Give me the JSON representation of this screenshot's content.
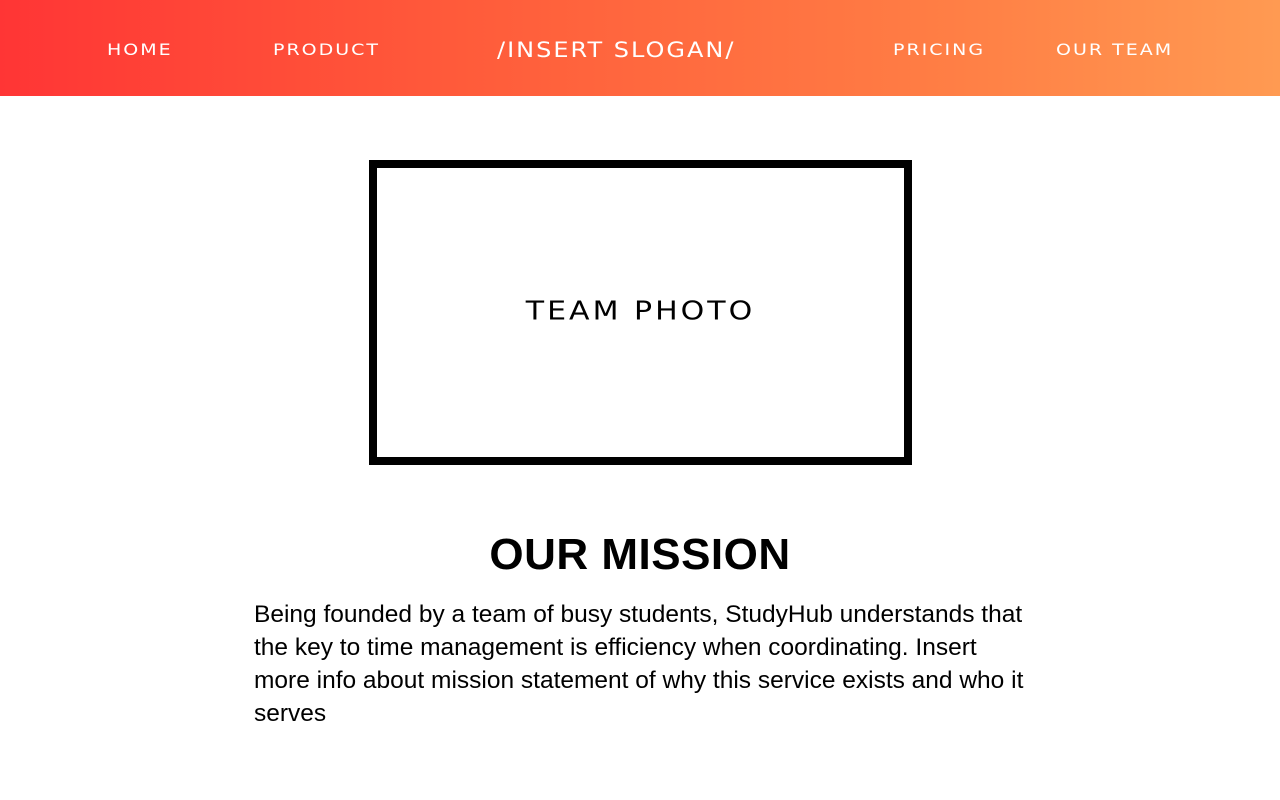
{
  "nav": {
    "home": "HOME",
    "product": "PRODUCT",
    "slogan": "/INSERT SLOGAN/",
    "pricing": "PRICING",
    "our_team": "OUR TEAM"
  },
  "hero": {
    "photo_label": "TEAM PHOTO"
  },
  "mission": {
    "title": "OUR MISSION",
    "body": "Being founded by a team of busy students, StudyHub understands that the key to time management is efficiency when coordinating. Insert more info about mission statement of why this service exists and who it serves"
  },
  "colors": {
    "header_gradient_start": "#ff3535",
    "header_gradient_end": "#ff9a52",
    "text": "#000000",
    "nav_text": "#ffffff"
  }
}
